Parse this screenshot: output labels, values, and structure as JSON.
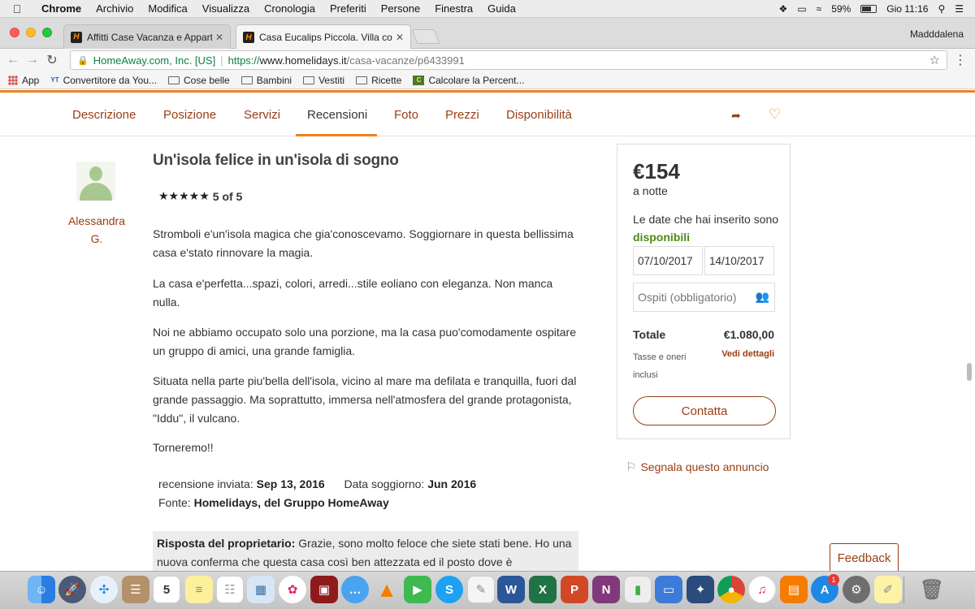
{
  "menubar": {
    "app": "Chrome",
    "items": [
      "Archivio",
      "Modifica",
      "Visualizza",
      "Cronologia",
      "Preferiti",
      "Persone",
      "Finestra",
      "Guida"
    ],
    "battery": "59%",
    "clock": "Gio 11:16"
  },
  "browser": {
    "tabs": [
      {
        "title": "Affitti Case Vacanza e Apparta"
      },
      {
        "title": "Casa Eucalips Piccola. Villa co"
      }
    ],
    "profile": "Madddalena",
    "address": {
      "secure_label": "HomeAway.com, Inc. [US]",
      "scheme": "https://",
      "host": "www.homelidays.it",
      "path": "/casa-vacanze/p6433991"
    },
    "bookmarks": [
      "App",
      "Convertitore da You...",
      "Cose belle",
      "Bambini",
      "Vestiti",
      "Ricette",
      "Calcolare la Percent..."
    ]
  },
  "subnav": {
    "items": [
      "Descrizione",
      "Posizione",
      "Servizi",
      "Recensioni",
      "Foto",
      "Prezzi",
      "Disponibilità"
    ],
    "active": "Recensioni"
  },
  "review": {
    "reviewer": "Alessandra G.",
    "title": "Un'isola felice in un'isola di sogno",
    "stars": "★★★★★",
    "score": "5 of 5",
    "paragraphs": [
      "Stromboli e'un'isola magica che gia'conoscevamo. Soggiornare in questa bellissima casa e'stato rinnovare la magia.",
      "La casa e'perfetta...spazi, colori, arredi...stile eoliano con eleganza. Non manca nulla.",
      "Noi ne abbiamo occupato solo una porzione, ma la casa puo'comodamente ospitare un gruppo di amici, una grande famiglia.",
      "Situata nella parte piu'bella dell'isola, vicino al mare ma defilata e tranquilla, fuori dal grande passaggio. Ma soprattutto, immersa nell'atmosfera del grande protagonista, \"Iddu\", il vulcano.",
      "Torneremo!!"
    ],
    "submitted_label": "recensione inviata:",
    "submitted_value": "Sep 13, 2016",
    "stay_label": "Data soggiorno:",
    "stay_value": "Jun 2016",
    "source_label": "Fonte:",
    "source_value": "Homelidays, del Gruppo HomeAway",
    "owner_label": "Risposta del proprietario:",
    "owner_text": "Grazie, sono molto feloce che siete stati bene. Ho una nuova conferma che questa casa così ben attezzata ed il posto dove è"
  },
  "booking": {
    "price": "€154",
    "per_night": "a notte",
    "avail_text": "Le date che hai inserito sono",
    "avail_status": "disponibili",
    "checkin": "07/10/2017",
    "checkout": "14/10/2017",
    "guests_placeholder": "Ospiti (obbligatorio)",
    "total_label": "Totale",
    "total_value": "€1.080,00",
    "tax_note": "Tasse e oneri inclusi",
    "details_link": "Vedi dettagli",
    "contact_button": "Contatta"
  },
  "report_link": "Segnala questo annuncio",
  "feedback_button": "Feedback",
  "dock_icons": [
    "finder-icon",
    "launchpad-icon",
    "safari-icon",
    "contacts-icon",
    "calendar-icon",
    "notes-icon",
    "reminders-icon",
    "preview-icon",
    "photos-icon",
    "photo-booth-icon",
    "messages-icon",
    "vlc-icon",
    "facetime-icon",
    "skype-icon",
    "textedit-icon",
    "word-icon",
    "excel-icon",
    "powerpoint-icon",
    "onenote-icon",
    "numbers-icon",
    "keynote-icon",
    "photoshop-icon",
    "chrome-icon",
    "itunes-icon",
    "ibooks-icon",
    "app-store-icon",
    "system-preferences-icon",
    "stickies-icon",
    "trash-icon"
  ],
  "calendar_day": "5",
  "app_store_badge": "1"
}
